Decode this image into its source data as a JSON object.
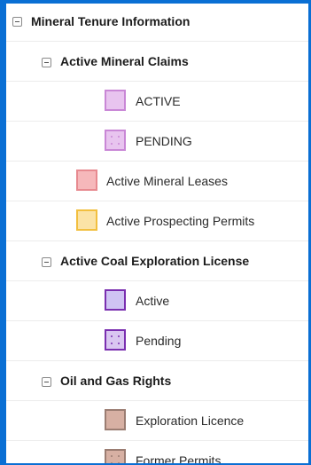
{
  "legend": {
    "root": {
      "label": "Mineral Tenure Information",
      "expanded": true
    },
    "mineral_claims": {
      "label": "Active Mineral Claims",
      "items": [
        {
          "label": "ACTIVE",
          "fill": "#e8c4ef",
          "border": "#c987d6",
          "pattern": "solid"
        },
        {
          "label": "PENDING",
          "fill": "#e8c4ef",
          "border": "#c987d6",
          "pattern": "dotted"
        }
      ]
    },
    "leases": {
      "label": "Active Mineral Leases",
      "fill": "#f6b8bb",
      "border": "#e78a90"
    },
    "permits": {
      "label": "Active Prospecting Permits",
      "fill": "#fbe3a6",
      "border": "#f2bf3f"
    },
    "coal": {
      "label": "Active Coal Exploration License",
      "items": [
        {
          "label": "Active",
          "fill": "#cfc3f3",
          "border": "#7a2fb0",
          "pattern": "solid"
        },
        {
          "label": "Pending",
          "fill": "#d9c6f1",
          "border": "#7a2fb0",
          "pattern": "dotted"
        }
      ]
    },
    "oil_gas": {
      "label": "Oil and Gas Rights",
      "items": [
        {
          "label": "Exploration Licence",
          "fill": "#d7b0a3",
          "border": "#9b7d72",
          "pattern": "solid"
        },
        {
          "label": "Former Permits",
          "fill": "#d7b0a3",
          "border": "#9b7d72",
          "pattern": "dotted"
        }
      ]
    }
  }
}
